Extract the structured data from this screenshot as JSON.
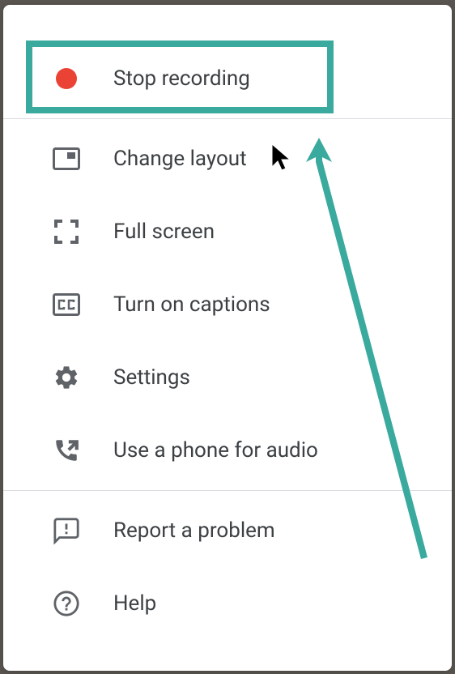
{
  "colors": {
    "highlight": "#3aa99e",
    "record": "#ea4335",
    "icon": "#5f6368",
    "text": "#3c4043"
  },
  "menu": {
    "stop_recording": "Stop recording",
    "change_layout": "Change layout",
    "full_screen": "Full screen",
    "captions": "Turn on captions",
    "settings": "Settings",
    "phone_audio": "Use a phone for audio",
    "report": "Report a problem",
    "help": "Help"
  }
}
